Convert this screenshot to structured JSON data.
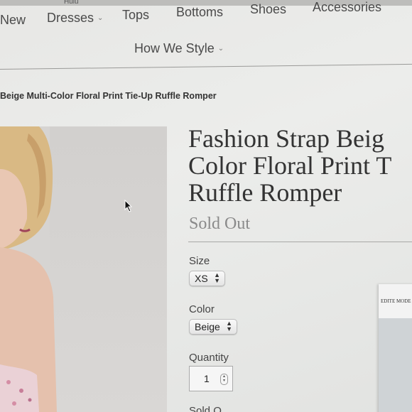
{
  "browser": {
    "tab_hint": "Hulu"
  },
  "nav": {
    "items": [
      {
        "label": "New",
        "has_dropdown": false
      },
      {
        "label": "Dresses",
        "has_dropdown": true
      },
      {
        "label": "Tops",
        "has_dropdown": false
      },
      {
        "label": "Bottoms",
        "has_dropdown": false
      },
      {
        "label": "Shoes",
        "has_dropdown": false
      },
      {
        "label": "Accessories",
        "has_dropdown": false
      },
      {
        "label": "How We Style",
        "has_dropdown": true
      }
    ],
    "chevron": "⌄"
  },
  "breadcrumb": "Beige Multi-Color Floral Print Tie-Up Ruffle Romper",
  "product": {
    "title_lines": [
      "Fashion Strap Beig",
      "Color Floral Print T",
      "Ruffle Romper"
    ],
    "status": "Sold Out",
    "size": {
      "label": "Size",
      "value": "XS"
    },
    "color": {
      "label": "Color",
      "value": "Beige"
    },
    "quantity": {
      "label": "Quantity",
      "value": "1"
    },
    "cutoff_text": "Sold O"
  },
  "side_card": {
    "text": "EDITE MODE"
  },
  "colors": {
    "text": "#333333",
    "muted": "#8a8a8a",
    "nav": "#4a4a4a"
  }
}
